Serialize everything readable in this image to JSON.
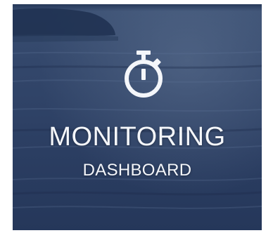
{
  "tile": {
    "title": "MONITORING",
    "subtitle": "DASHBOARD",
    "icon": "stopwatch-icon"
  },
  "colors": {
    "overlay": "#2f4368",
    "text": "#f4f6fa"
  }
}
